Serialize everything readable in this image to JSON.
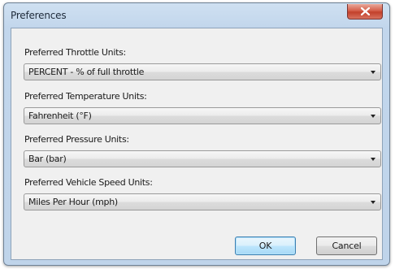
{
  "window": {
    "title": "Preferences"
  },
  "fields": [
    {
      "label": "Preferred Throttle Units:",
      "value": "PERCENT - % of full throttle"
    },
    {
      "label": "Preferred Temperature Units:",
      "value": "Fahrenheit (°F)"
    },
    {
      "label": "Preferred Pressure Units:",
      "value": "Bar (bar)"
    },
    {
      "label": "Preferred Vehicle Speed Units:",
      "value": "Miles Per Hour (mph)"
    }
  ],
  "buttons": {
    "ok_label": "OK",
    "cancel_label": "Cancel"
  },
  "icons": {
    "close": "close-icon",
    "dropdown": "chevron-down-icon"
  },
  "colors": {
    "close_button": "#c94a35",
    "default_button_border": "#3c7fb1",
    "title_bar": "#c2d6ec"
  }
}
